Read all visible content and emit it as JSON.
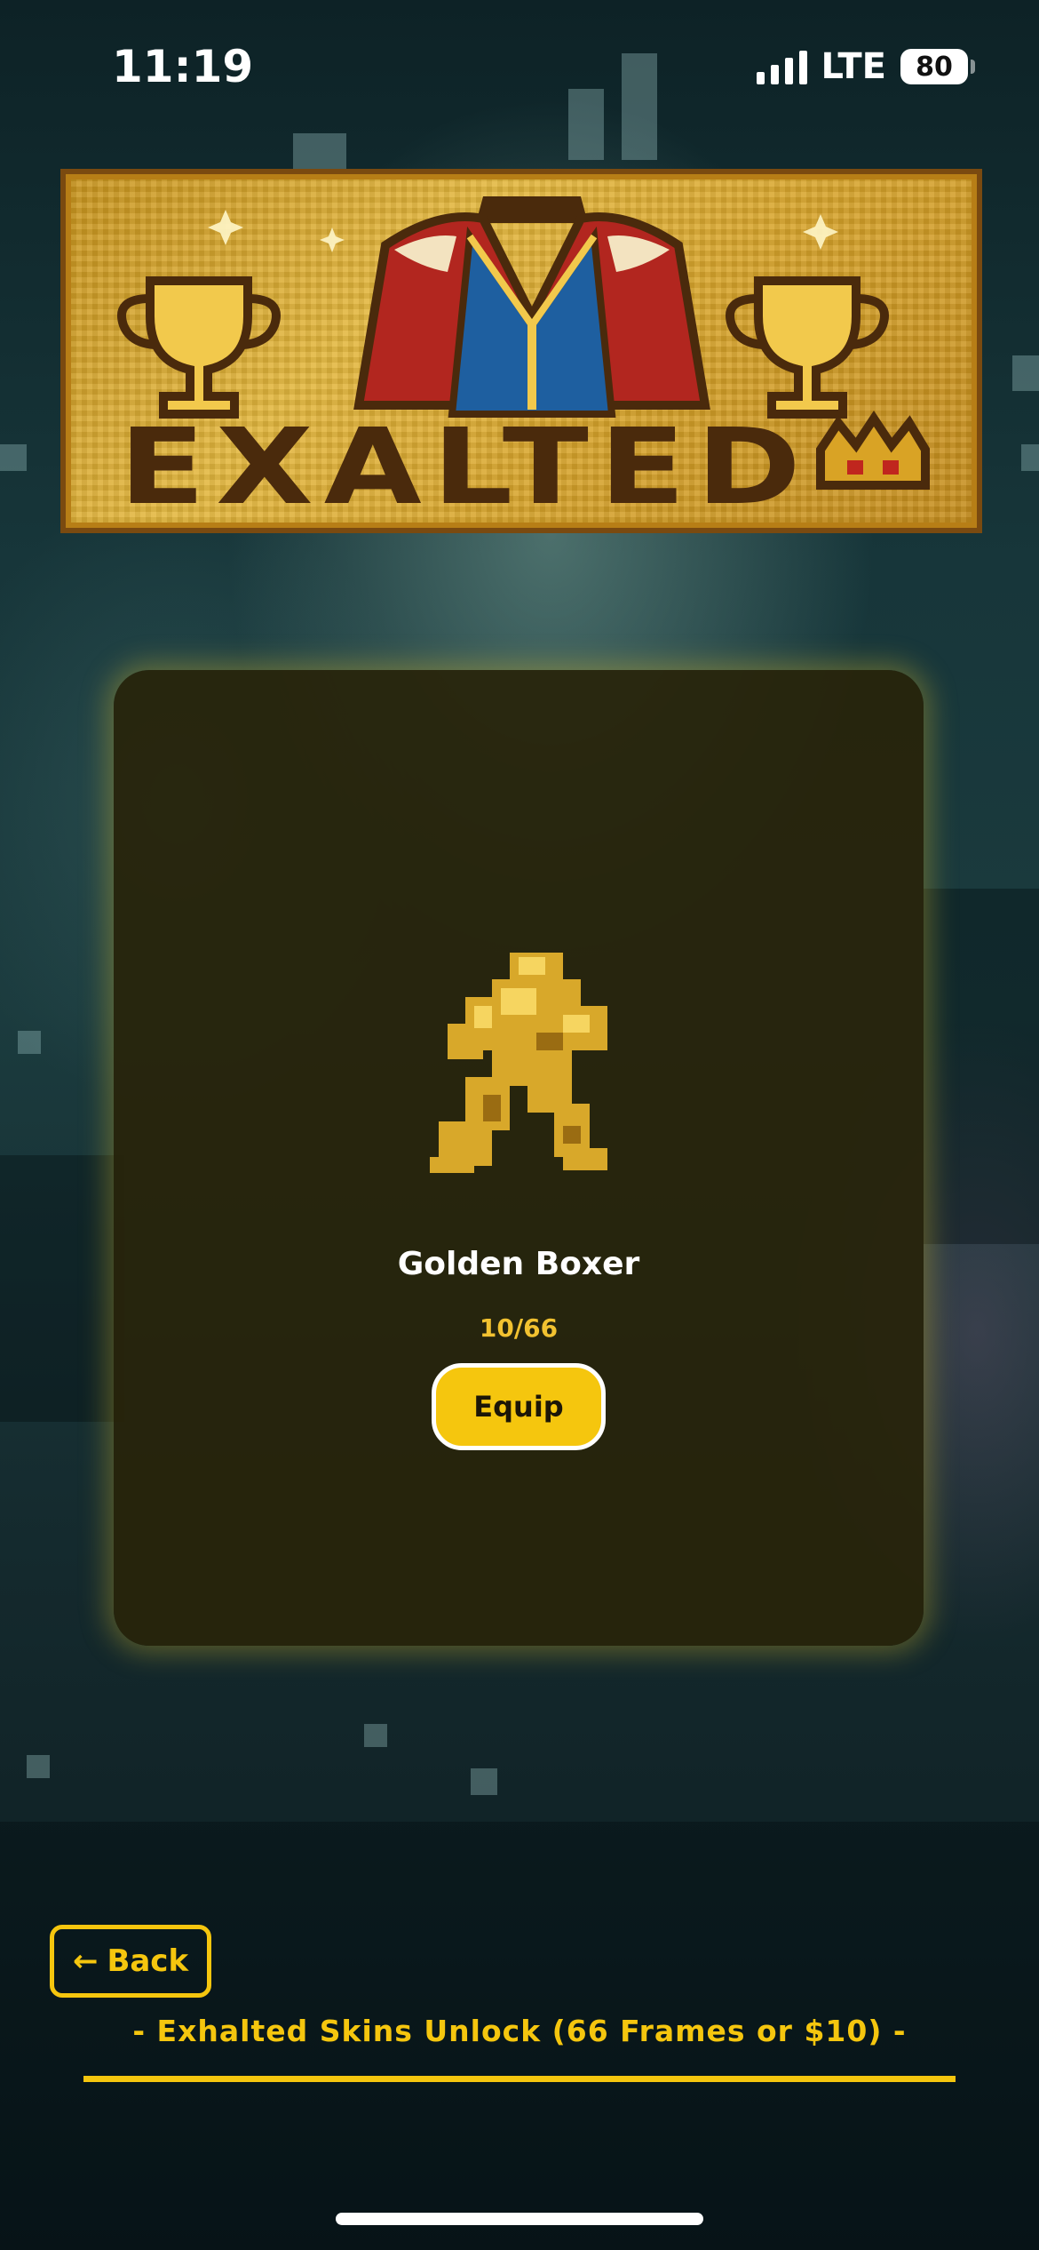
{
  "status_bar": {
    "time": "11:19",
    "network": "LTE",
    "battery": "80"
  },
  "banner": {
    "title": "EXALTED",
    "icons": [
      "trophy-icon",
      "royal-robe-icon",
      "trophy-icon",
      "crown-icon"
    ]
  },
  "skin": {
    "name": "Golden Boxer",
    "count": "10/66",
    "equip_label": "Equip",
    "sprite": "golden-boxer-sprite"
  },
  "footer": {
    "back_label": "Back",
    "back_arrow": "←",
    "unlock_text": "- Exhalted Skins Unlock (66 Frames or $10) -"
  },
  "colors": {
    "accent": "#f5c60e",
    "card_bg": "#28240a",
    "banner_gold": "#e3b73e",
    "banner_text": "#4a2a0c"
  }
}
